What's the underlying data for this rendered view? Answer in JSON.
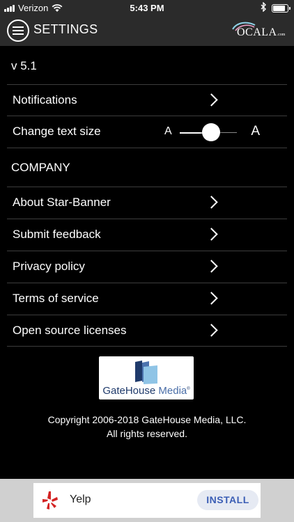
{
  "status_bar": {
    "carrier": "Verizon",
    "time": "5:43 PM",
    "battery_level": 0.95
  },
  "header": {
    "title": "SETTINGS",
    "brand_logo_text": "OCALA",
    "brand_logo_suffix": ".com"
  },
  "version": "v 5.1",
  "rows_top": [
    {
      "label": "Notifications"
    },
    {
      "label": "Change text size"
    }
  ],
  "text_size_slider": {
    "small_label": "A",
    "large_label": "A",
    "value": 0.55
  },
  "company_section": {
    "heading": "COMPANY",
    "items": [
      {
        "label": "About Star-Banner"
      },
      {
        "label": "Submit feedback"
      },
      {
        "label": "Privacy policy"
      },
      {
        "label": "Terms of service"
      },
      {
        "label": "Open source licenses"
      }
    ]
  },
  "publisher_logo": {
    "name": "GateHouse",
    "name_suffix": "Media",
    "mark": "®"
  },
  "copyright": {
    "line1": "Copyright 2006-2018 GateHouse Media, LLC.",
    "line2": "All rights reserved."
  },
  "ad": {
    "app_name": "Yelp",
    "install_label": "INSTALL",
    "yelp_color": "#d32323"
  }
}
